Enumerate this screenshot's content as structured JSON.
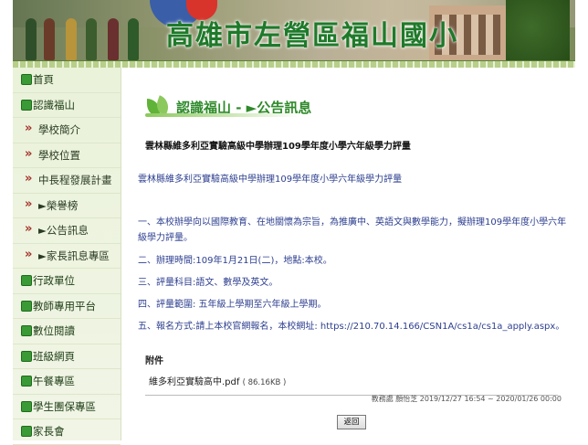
{
  "header": {
    "title": "高雄市左營區福山國小"
  },
  "sidebar": {
    "items": [
      {
        "label": "首頁"
      },
      {
        "label": "認識福山"
      },
      {
        "label": "學校簡介"
      },
      {
        "label": "學校位置"
      },
      {
        "label": "中長程發展計畫"
      },
      {
        "label": "►榮譽榜"
      },
      {
        "label": "►公告訊息"
      },
      {
        "label": "►家長訊息專區"
      },
      {
        "label": "行政單位"
      },
      {
        "label": "教師專用平台"
      },
      {
        "label": "數位閱讀"
      },
      {
        "label": "班級網頁"
      },
      {
        "label": "午餐專區"
      },
      {
        "label": "學生團保專區"
      },
      {
        "label": "家長會"
      }
    ]
  },
  "main": {
    "breadcrumb": "認識福山 - ►公告訊息",
    "post_title": "雲林縣維多利亞實驗高級中學辦理109學年度小學六年級學力評量",
    "lead": "雲林縣維多利亞實驗高級中學辦理109學年度小學六年級學力評量",
    "paragraphs": [
      "一、本校辦學向以國際教育、在地關懷為宗旨，為推廣中、英語文與數學能力，擬辦理109學年度小學六年級學力評量。",
      "二、辦理時間:109年1月21日(二)，地點:本校。",
      "三、評量科目:語文、數學及英文。",
      "四、評量範圍: 五年級上學期至六年級上學期。",
      "五、報名方式:請上本校官網報名，本校網址: https://210.70.14.166/CSN1A/cs1a/cs1a_apply.aspx。"
    ],
    "attachment_heading": "附件",
    "attachment_name": "維多利亞實驗高中.pdf",
    "attachment_size": "( 86.16KB )",
    "meta": "教務處 顏怡芝 2019/12/27 16:54 ~ 2020/01/26 00:00",
    "back_label": "返回"
  }
}
